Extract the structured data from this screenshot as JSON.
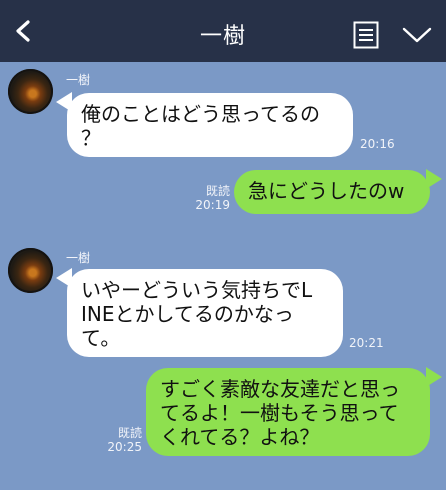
{
  "header": {
    "title": "一樹",
    "back_icon": "chevron-left-icon",
    "note_icon": "note-icon",
    "menu_icon": "chevron-down-icon",
    "bg_color": "#273148"
  },
  "chat": {
    "bg_color": "#7b99c6",
    "messages": [
      {
        "side": "left",
        "sender": "一樹",
        "lines": [
          "俺のことはどう思ってるの",
          "？"
        ],
        "time": "20:16"
      },
      {
        "side": "right",
        "lines": [
          "急にどうしたのw"
        ],
        "read": "既読",
        "time": "20:19"
      },
      {
        "side": "left",
        "sender": "一樹",
        "lines": [
          "いやーどういう気持ちでL",
          "INEとかしてるのかなっ",
          "て。"
        ],
        "time": "20:21"
      },
      {
        "side": "right",
        "lines": [
          "すごく素敵な友達だと思っ",
          "てるよ！一樹もそう思って",
          "くれてる？よね？"
        ],
        "read": "既読",
        "time": "20:25"
      }
    ]
  }
}
